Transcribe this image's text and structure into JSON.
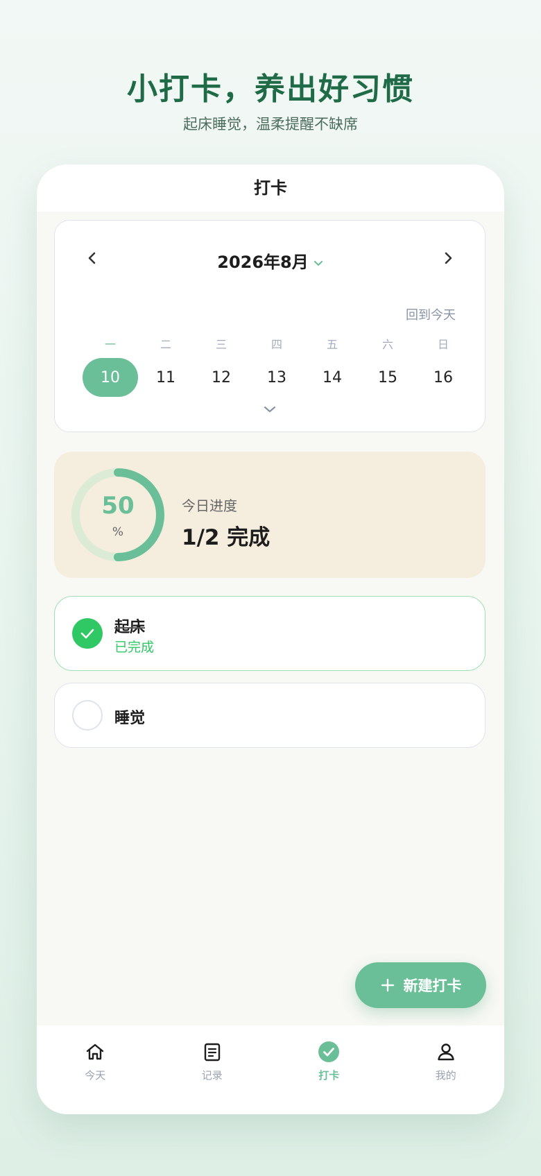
{
  "hero": {
    "title": "小打卡，养出好习惯",
    "subtitle": "起床睡觉，温柔提醒不缺席"
  },
  "header": {
    "title": "打卡"
  },
  "calendar": {
    "month_label": "2026年8月",
    "back_to_today": "回到今天",
    "weekdays": [
      "一",
      "二",
      "三",
      "四",
      "五",
      "六",
      "日"
    ],
    "dates": [
      "10",
      "11",
      "12",
      "13",
      "14",
      "15",
      "16"
    ],
    "selected_index": 0
  },
  "progress": {
    "percent_value": "50",
    "percent_unit": "%",
    "percent": 50,
    "label": "今日进度",
    "value": "1/2 完成"
  },
  "tasks": [
    {
      "name": "起床",
      "status": "已完成",
      "done": true
    },
    {
      "name": "睡觉",
      "status": "",
      "done": false
    }
  ],
  "fab": {
    "label": "新建打卡",
    "icon": "plus-icon"
  },
  "tabbar": {
    "items": [
      {
        "label": "今天",
        "icon": "home-icon",
        "active": false
      },
      {
        "label": "记录",
        "icon": "document-icon",
        "active": false
      },
      {
        "label": "打卡",
        "icon": "check-circle-icon",
        "active": true
      },
      {
        "label": "我的",
        "icon": "user-icon",
        "active": false
      }
    ]
  },
  "colors": {
    "accent": "#6bbf98",
    "hero_title": "#1f6b47",
    "done_green": "#2fc864",
    "progress_bg": "#f5eedf",
    "ring_track": "#dcebd6"
  }
}
